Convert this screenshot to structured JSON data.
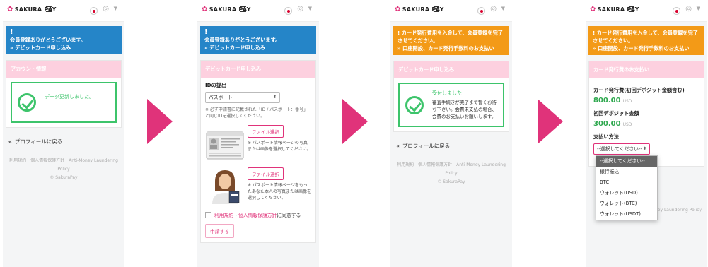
{
  "brand": {
    "name": "SAKURA PAY",
    "accent": "#e0337a",
    "pink_header": "#fdd0df",
    "success": "#3dc46b",
    "info": "#2585c8",
    "warning": "#f39a17"
  },
  "s1": {
    "alert_line1": "会員登録ありがとうございます。",
    "alert_link": "デビットカード申し込み",
    "card_title": "アカウント情報",
    "success_msg": "データ更新しました。",
    "back_label": "プロフィールに戻る",
    "footer_links": "利用規約　個人情報保護方針　Anti-Money Laundering Policy",
    "copyright": "© SakuraPay"
  },
  "s2": {
    "alert_line1": "会員登録ありがとうございます。",
    "alert_link": "デビットカード申し込み",
    "card_title": "デビットカード申し込み",
    "id_label": "IDの提出",
    "id_select_value": "パスポート",
    "id_note": "※ 必ず申請書に記載された「ID / パスポート：番号」と同じIDを選択してください。",
    "file_btn_1": "ファイル選択",
    "file_desc_1": "※ パスポート情報ページの写真または画像を選択してください。",
    "file_btn_2": "ファイル選択",
    "file_desc_2": "※ パスポート情報ページをもったあなた本人の写真または画像を選択してください。",
    "agree_terms": "利用規約",
    "agree_sep": "・",
    "agree_privacy": "個人情報保護方針",
    "agree_suffix": "に同意する",
    "apply_label": "申請する",
    "passport_text": "PASSPORT"
  },
  "s3": {
    "alert_line1": "カード発行費用を入金して、会員登録を完了させてください。",
    "alert_link": "口座開設、カード発行手数料のお支払い",
    "card_title": "デビットカード申し込み",
    "success_msg": "受付しました",
    "success_sub": "審査手続きが完了まで暫くお待ち下さい。会費未支払の場合、会費のお支払いお願いします。",
    "back_label": "プロフィールに戻る",
    "footer_links": "利用規約　個人情報保護方針　Anti-Money Laundering Policy",
    "copyright": "© SakuraPay"
  },
  "s4": {
    "alert_line1": "カード発行費用を入金して、会員登録を完了させてください。",
    "alert_link": "口座開設、カード発行手数料のお支払い",
    "card_title": "カード発行費のお支払い",
    "fee1_label": "カード発行費(初回デポジット金額含む)",
    "fee1_amount": "800.00",
    "fee1_unit": "USD",
    "fee2_label": "初回デポジット金額",
    "fee2_amount": "300.00",
    "fee2_unit": "USD",
    "pay_label": "支払い方法",
    "pay_select": "--選択してください--",
    "options": [
      "--選択してください--",
      "銀行振込",
      "BTC",
      "ウォレット(USD)",
      "ウォレット(BTC)",
      "ウォレット(USDT)"
    ],
    "footer_partial": "-Money Laundering Policy"
  }
}
